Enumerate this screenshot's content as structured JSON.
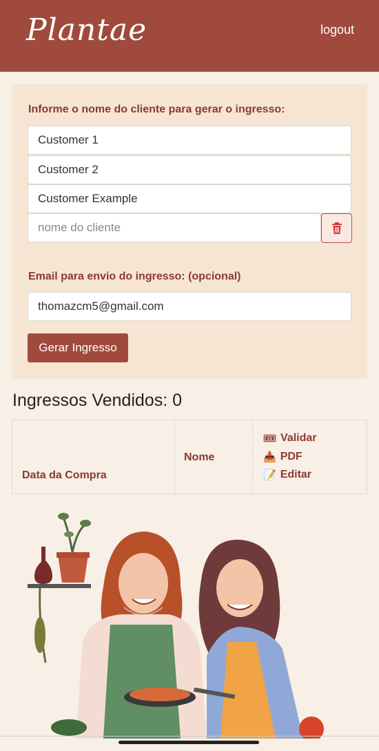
{
  "header": {
    "logo": "Plantae",
    "logout_label": "logout"
  },
  "form": {
    "client_label": "Informe o nome do cliente para gerar o ingresso:",
    "clients": [
      "Customer 1",
      "Customer 2",
      "Customer Example"
    ],
    "client_placeholder": "nome do cliente",
    "email_label": "Email para envio do ingresso: (opcional)",
    "email_value": "thomazcm5@gmail.com",
    "generate_label": "Gerar Ingresso"
  },
  "sold": {
    "title": "Ingressos Vendidos: 0"
  },
  "table": {
    "col_date": "Data da Compra",
    "col_name": "Nome",
    "actions": [
      {
        "icon": "ticket-icon",
        "glyph": "🎟",
        "label": "Validar"
      },
      {
        "icon": "inbox-tray-icon",
        "glyph": "📥",
        "label": "PDF"
      },
      {
        "icon": "memo-icon",
        "glyph": "📝",
        "label": "Editar"
      }
    ]
  },
  "colors": {
    "brand": "#a04a3d",
    "label": "#8c3a30",
    "background": "#f8efe7",
    "card": "#f6e5d3"
  }
}
